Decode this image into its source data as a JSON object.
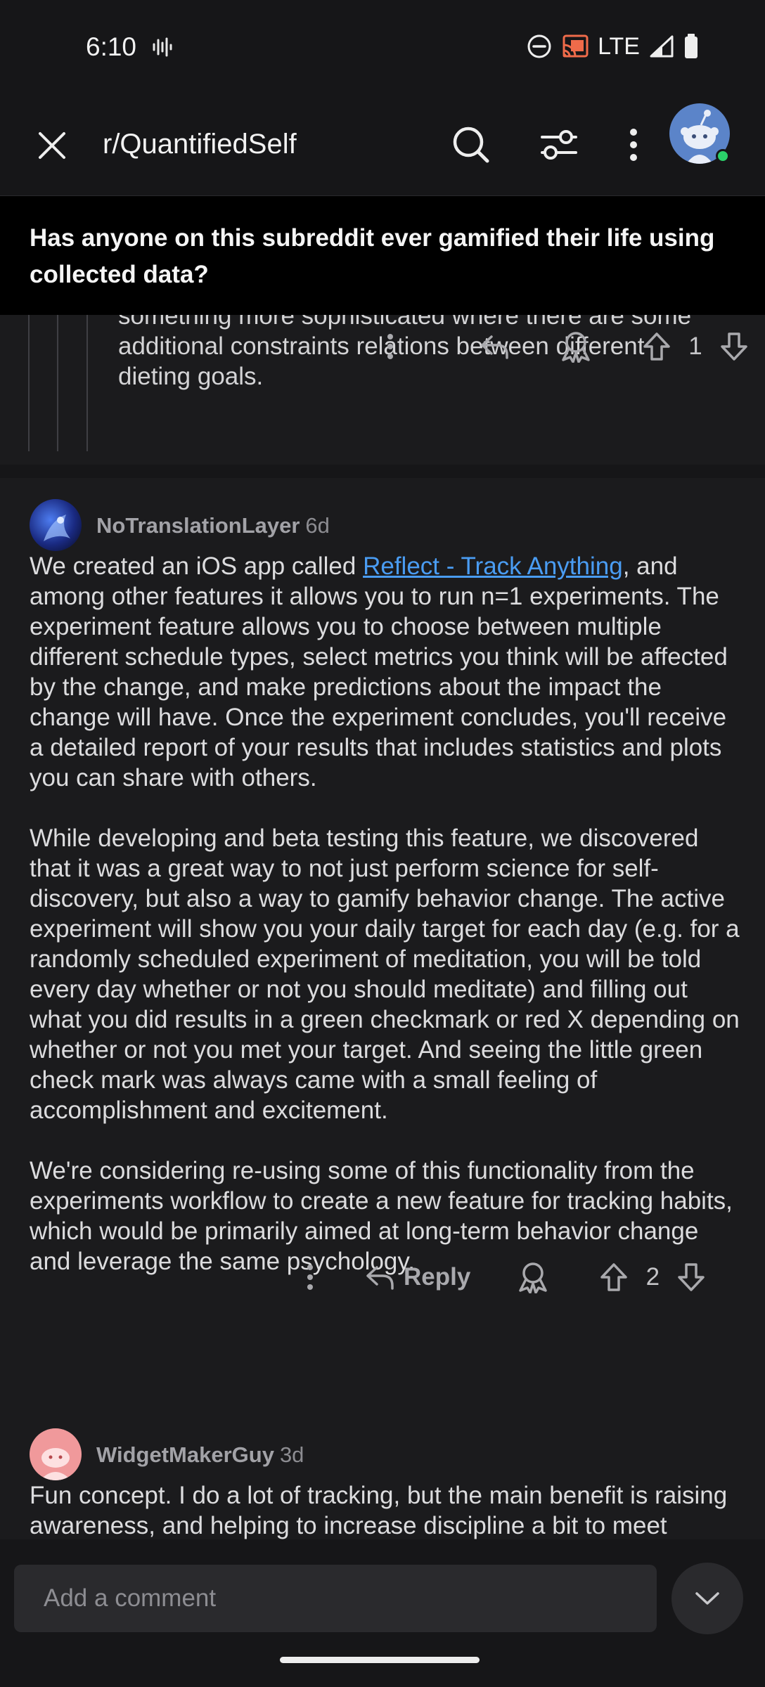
{
  "status_bar": {
    "time": "6:10",
    "network": "LTE",
    "icons": [
      "sound-wave-icon",
      "do-not-disturb-icon",
      "cast-icon",
      "signal-icon",
      "battery-icon"
    ]
  },
  "top_bar": {
    "subreddit": "r/QuantifiedSelf",
    "icons": [
      "close-icon",
      "search-icon",
      "filter-icon",
      "more-vertical-icon",
      "avatar"
    ]
  },
  "pinned_post": {
    "title": "Has anyone on this subreddit ever gamified their life using collected data?"
  },
  "comments": [
    {
      "text_lines": [
        "something more sophisticated where there are some",
        "additional constraints relations between different",
        "dieting goals."
      ],
      "votes": "1"
    },
    {
      "username": "NoTranslationLayer",
      "age": "6d",
      "para1_before_link": "We created an iOS app called ",
      "link_text": "Reflect - Track Anything",
      "para1_after_link": ", and among other features it allows you to run n=1 experiments. The experiment feature allows you to choose between multiple different schedule types, select metrics you think will be affected by the change, and make predictions about the impact the change will have. Once the experiment concludes, you'll receive a detailed report of your results that includes statistics and plots you can share with others.",
      "para2": "While developing and beta testing this feature, we discovered that it was a great way to not just perform science for self-discovery, but also a way to gamify behavior change. The active experiment will show you your daily target for each day (e.g. for a randomly scheduled experiment of meditation, you will be told every day whether or not you should meditate) and filling out what you did results in a green checkmark or red X depending on whether or not you met your target. And seeing the little green check mark was always came with a small feeling of accomplishment and excitement.",
      "para3": "We're considering re-using some of this functionality from the experiments workflow to create a new feature for tracking habits, which would be primarily aimed at long-term behavior change and leverage the same psychology.",
      "reply_label": "Reply",
      "votes": "2"
    },
    {
      "username": "WidgetMakerGuy",
      "age": "3d",
      "text": "Fun concept. I do a lot of tracking, but the main benefit is raising awareness, and helping to increase discipline a bit to meet certain targets. Before I started building my own tools I"
    }
  ],
  "composer": {
    "placeholder": "Add a comment"
  },
  "colors": {
    "background": "#161618",
    "comment_bg": "#1b1b1d",
    "link": "#4a9cf2",
    "online": "#2bd069"
  }
}
